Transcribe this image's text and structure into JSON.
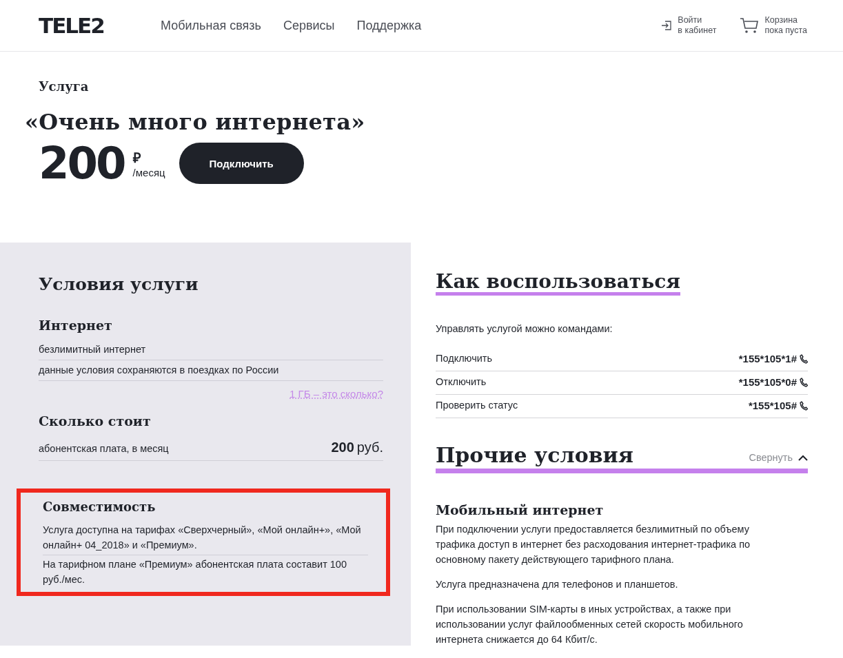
{
  "header": {
    "logo": "TELE2",
    "nav": [
      {
        "label": "Мобильная связь"
      },
      {
        "label": "Сервисы"
      },
      {
        "label": "Поддержка"
      }
    ],
    "login": {
      "line1": "Войти",
      "line2": "в кабинет"
    },
    "cart": {
      "line1": "Корзина",
      "line2": "пока пуста"
    }
  },
  "hero": {
    "eyebrow": "Услуга",
    "title": "«Очень много интернета»",
    "price": "200",
    "currency": "₽",
    "period": "/месяц",
    "button": "Подключить"
  },
  "conditions": {
    "title": "Условия услуги",
    "groups": [
      {
        "title": "Интернет",
        "rows": [
          {
            "label": "безлимитный интернет"
          },
          {
            "label": "данные условия сохраняются в поездках по России"
          }
        ],
        "link": "1 ГБ – это сколько?"
      },
      {
        "title": "Сколько стоит",
        "rows": [
          {
            "label": "абонентская плата, в месяц",
            "value": "200",
            "unit": "руб."
          }
        ]
      }
    ],
    "compatibility": {
      "title": "Совместимость",
      "highlighted": true,
      "rows": [
        {
          "label": "Услуга доступна на тарифах «Сверхчерный», «Мой онлайн+», «Мой онлайн+ 04_2018» и «Премиум»."
        },
        {
          "label": "На тарифном плане «Премиум» абонентская плата составит 100 руб./мес."
        }
      ]
    }
  },
  "usage": {
    "title": "Как воспользоваться",
    "intro": "Управлять услугой можно командами:",
    "commands": [
      {
        "label": "Подключить",
        "code": "*155*105*1#"
      },
      {
        "label": "Отключить",
        "code": "*155*105*0#"
      },
      {
        "label": "Проверить статус",
        "code": "*155*105#"
      }
    ]
  },
  "other": {
    "title": "Прочие условия",
    "toggle": "Свернуть",
    "expanded": true,
    "section_title": "Мобильный интернет",
    "paragraphs": [
      "При подключении услуги предоставляется безлимитный по объему трафика доступ в интернет без расходования интернет-трафика по основному пакету действующего тарифного плана.",
      "Услуга предназначена для телефонов и планшетов.",
      "При использовании SIM-карты в иных устройствах, а также при использовании услуг файлообменных сетей скорость мобильного интернета снижается до 64 Кбит/с."
    ]
  }
}
